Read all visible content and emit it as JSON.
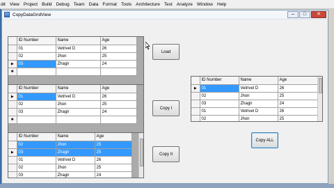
{
  "menubar": [
    "dit",
    "View",
    "Project",
    "Build",
    "Debug",
    "Team",
    "Data",
    "Format",
    "Tools",
    "Architecture",
    "Test",
    "Analyze",
    "Window",
    "Help"
  ],
  "window": {
    "title": "CopyDataGridView"
  },
  "headers": [
    "ID Number",
    "Name",
    "Age"
  ],
  "grid1": {
    "rows": [
      {
        "id": "01",
        "name": "Vetrivel D",
        "age": "26"
      },
      {
        "id": "02",
        "name": "Jhon",
        "age": "25"
      },
      {
        "id": "03",
        "name": "Zhagir",
        "age": "24"
      }
    ],
    "current_row_marker": "▶",
    "new_row_marker": "✱"
  },
  "grid2": {
    "rows": [
      {
        "id": "01",
        "name": "Vetrivel D",
        "age": "26"
      },
      {
        "id": "02",
        "name": "Jhon",
        "age": "25"
      },
      {
        "id": "03",
        "name": "Zhagir",
        "age": "24"
      }
    ],
    "current_row_marker": "▶",
    "new_row_marker": "✱"
  },
  "grid3": {
    "rows": [
      {
        "id": "02",
        "name": "Jhon",
        "age": "25"
      },
      {
        "id": "03",
        "name": "Zhagir",
        "age": "25"
      },
      {
        "id": "01",
        "name": "Vetrivel D",
        "age": "26"
      },
      {
        "id": "02",
        "name": "Jhon",
        "age": "25"
      },
      {
        "id": "03",
        "name": "Zhagir",
        "age": "24"
      }
    ],
    "current_row_marker": "▶"
  },
  "grid4": {
    "rows": [
      {
        "id": "01",
        "name": "Vetrivel D",
        "age": "26"
      },
      {
        "id": "02",
        "name": "Jhon",
        "age": "25"
      },
      {
        "id": "03",
        "name": "Zhagir",
        "age": "24"
      },
      {
        "id": "01",
        "name": "Vetrivel D",
        "age": "26"
      },
      {
        "id": "02",
        "name": "Jhon",
        "age": "25"
      }
    ],
    "current_row_marker": "▶"
  },
  "buttons": {
    "load": "Load",
    "copy1": "Copy I",
    "copy2": "Copy II",
    "copy_all": "Copy ALL"
  },
  "caption": {
    "minimize": "–",
    "maximize": "□",
    "close": "✕"
  },
  "colors": {
    "selection": "#3399ff",
    "window_bg": "#f0f0f0",
    "grid_bg": "#ababab"
  }
}
